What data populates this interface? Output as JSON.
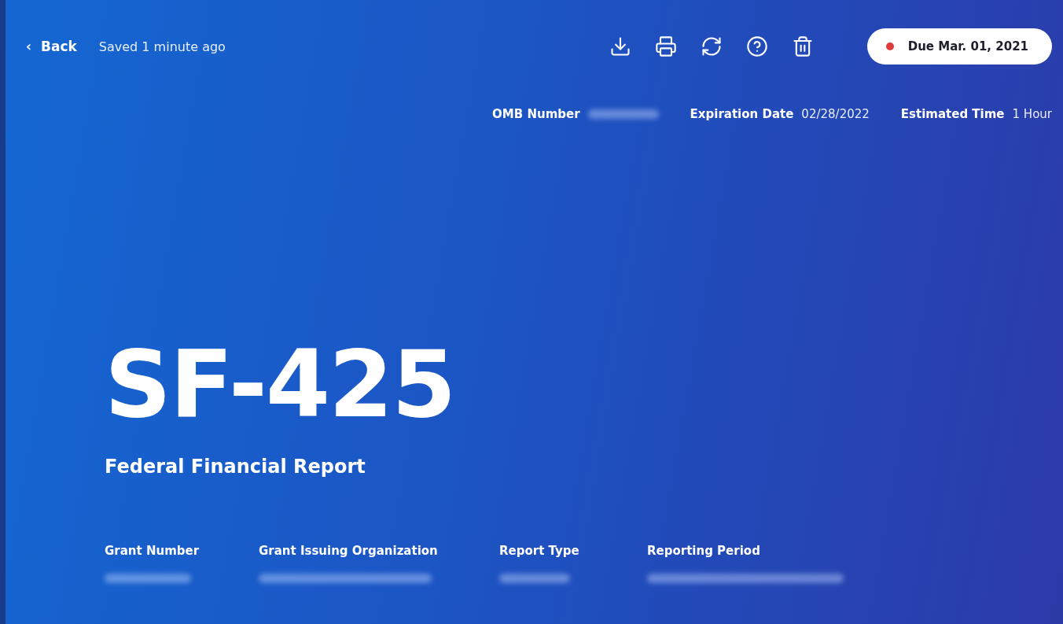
{
  "top_bar": {
    "back": {
      "icon": "‹",
      "label": "Back"
    },
    "save_status": "Saved 1 minute ago",
    "actions": [
      {
        "kind": "download"
      },
      {
        "kind": "print"
      },
      {
        "kind": "refresh"
      },
      {
        "kind": "help"
      },
      {
        "kind": "delete"
      }
    ],
    "due": {
      "label": "Due Mar. 01, 2021",
      "color": "#e03a3a"
    }
  },
  "meta": [
    {
      "label": "OMB Number",
      "value_redacted": true
    },
    {
      "label": "Expiration Date",
      "value": "02/28/2022"
    },
    {
      "label": "Estimated Time",
      "value": "1 Hour"
    }
  ],
  "form": {
    "code": "SF-425",
    "title": "Federal Financial Report"
  },
  "details": [
    {
      "label": "Grant Number",
      "value_redacted": true
    },
    {
      "label": "Grant Issuing Organization",
      "value_redacted": true
    },
    {
      "label": "Report Type",
      "value_redacted": true
    },
    {
      "label": "Reporting Period",
      "value_redacted": true
    }
  ]
}
